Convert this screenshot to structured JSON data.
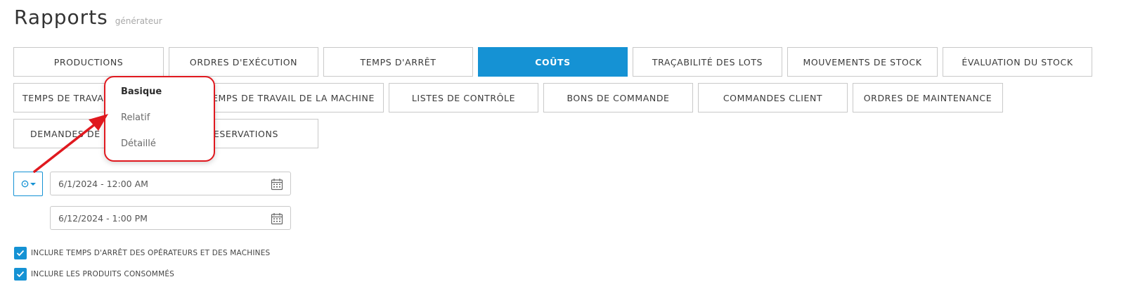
{
  "header": {
    "title": "Rapports",
    "subtitle": "générateur"
  },
  "tabs": [
    {
      "label": "PRODUCTIONS",
      "active": false
    },
    {
      "label": "ORDRES D'EXÉCUTION",
      "active": false
    },
    {
      "label": "TEMPS D'ARRÊT",
      "active": false
    },
    {
      "label": "COÛTS",
      "active": true
    },
    {
      "label": "TRAÇABILITÉ DES LOTS",
      "active": false
    },
    {
      "label": "MOUVEMENTS DE STOCK",
      "active": false
    },
    {
      "label": "ÉVALUATION DU STOCK",
      "active": false
    },
    {
      "label": "TEMPS DE TRAVAI",
      "active": false
    },
    {
      "label": "EMPS DE TRAVAIL DE LA MACHINE",
      "active": false
    },
    {
      "label": "LISTES DE CONTRÔLE",
      "active": false
    },
    {
      "label": "BONS DE COMMANDE",
      "active": false
    },
    {
      "label": "COMMANDES CLIENT",
      "active": false
    },
    {
      "label": "ORDRES DE MAINTENANCE",
      "active": false
    },
    {
      "label": "DEMANDES DE M",
      "active": false
    },
    {
      "label": "ESERVATIONS",
      "active": false
    }
  ],
  "dropdown": {
    "items": [
      {
        "label": "Basique",
        "selected": true
      },
      {
        "label": "Relatif",
        "selected": false
      },
      {
        "label": "Détaillé",
        "selected": false
      }
    ],
    "highlight_color": "#e0191f"
  },
  "date_range": {
    "start": "6/1/2024 - 12:00 AM",
    "end": "6/12/2024 - 1:00 PM",
    "range_icon": "clock-icon",
    "calendar_icon": "calendar-icon"
  },
  "options": [
    {
      "label": "INCLURE TEMPS D'ARRÊT DES OPÉRATEURS ET DES MACHINES",
      "checked": true
    },
    {
      "label": "INCLURE LES PRODUITS CONSOMMÉS",
      "checked": true
    }
  ],
  "colors": {
    "accent": "#1592d4",
    "annotation": "#e0191f"
  }
}
